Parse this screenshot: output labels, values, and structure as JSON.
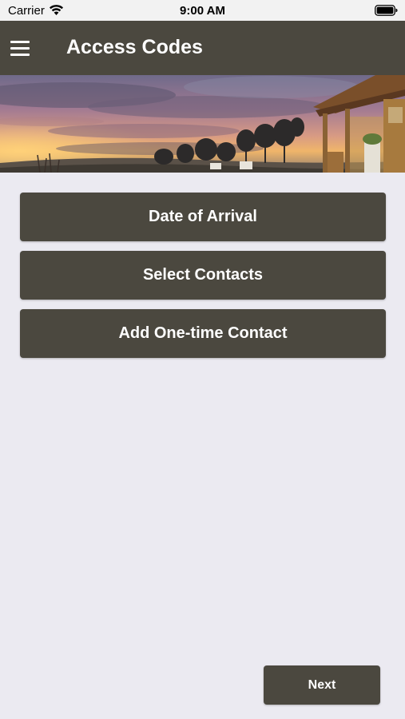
{
  "status_bar": {
    "carrier": "Carrier",
    "time": "9:00 AM"
  },
  "nav": {
    "title": "Access Codes",
    "menu_icon": "hamburger-menu-icon"
  },
  "actions": {
    "date_of_arrival": "Date of Arrival",
    "select_contacts": "Select Contacts",
    "add_one_time_contact": "Add One-time Contact"
  },
  "footer": {
    "next_label": "Next"
  },
  "colors": {
    "primary": "#4b483f",
    "background": "#ebeaf1",
    "text_on_primary": "#ffffff"
  }
}
